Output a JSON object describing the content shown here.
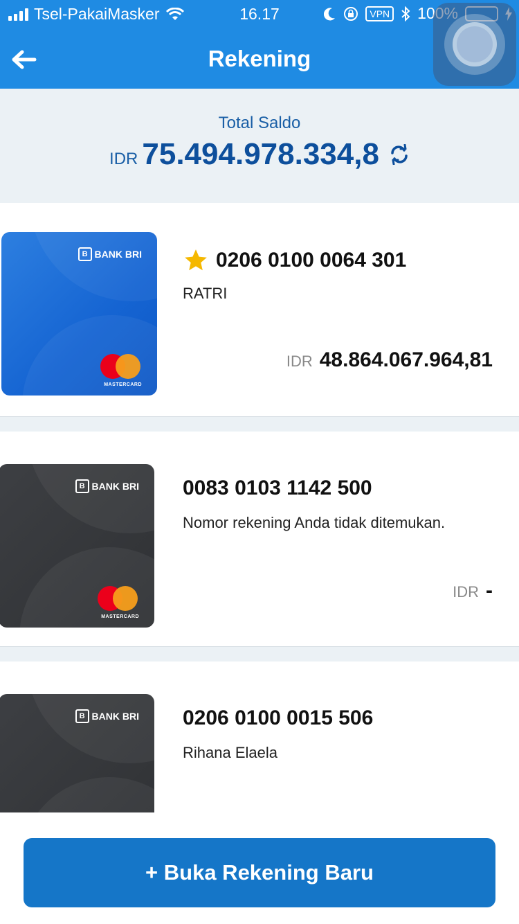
{
  "status_bar": {
    "carrier": "Tsel-PakaiMasker",
    "time": "16.17",
    "vpn": "VPN",
    "battery": "100%"
  },
  "nav": {
    "title": "Rekening"
  },
  "summary": {
    "label": "Total Saldo",
    "currency": "IDR",
    "amount": "75.494.978.334,8"
  },
  "accounts": [
    {
      "number": "0206 0100 0064 301",
      "name": "RATRI",
      "currency": "IDR",
      "balance": "48.864.067.964,81",
      "favorite": true,
      "card_style": "blue",
      "bank": "BANK BRI",
      "network": "MASTERCARD"
    },
    {
      "number": "0083 0103 1142 500",
      "name": "Nomor rekening Anda tidak ditemukan.",
      "currency": "IDR",
      "balance": "-",
      "favorite": false,
      "card_style": "dark",
      "bank": "BANK BRI",
      "network": "MASTERCARD"
    },
    {
      "number": "0206 0100 0015 506",
      "name": "Rihana Elaela",
      "currency": "",
      "balance": "",
      "favorite": false,
      "card_style": "dark",
      "bank": "BANK BRI",
      "network": ""
    }
  ],
  "footer": {
    "open_account_label": "+ Buka Rekening Baru"
  },
  "colors": {
    "primary": "#1f8be3",
    "button": "#1576c8",
    "accent_text": "#0d4f9c",
    "background": "#ebf1f5",
    "star": "#f5b800"
  }
}
